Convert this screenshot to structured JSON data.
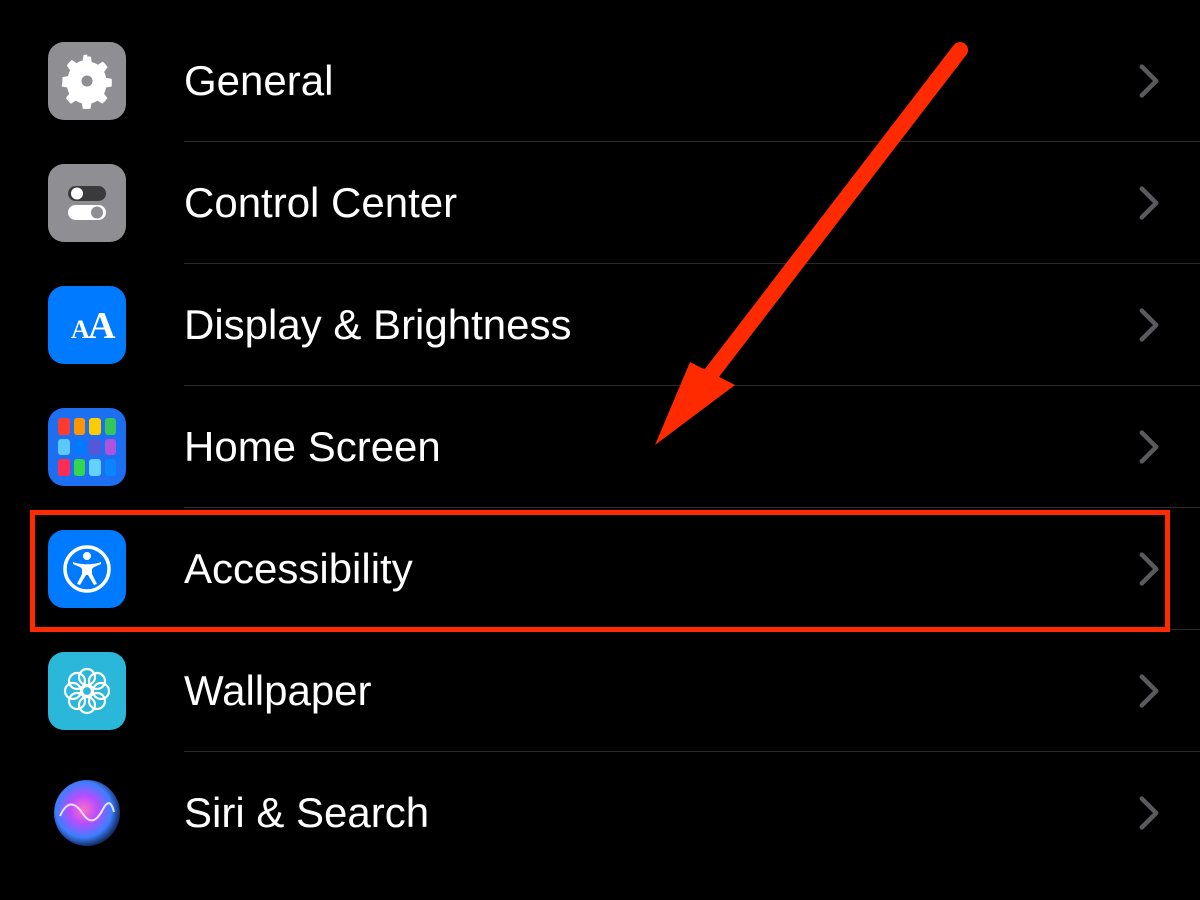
{
  "settings": {
    "items": [
      {
        "id": "general",
        "label": "General",
        "icon": "gear-icon",
        "icon_bg": "#8e8e93"
      },
      {
        "id": "control-center",
        "label": "Control Center",
        "icon": "toggles-icon",
        "icon_bg": "#8e8e93"
      },
      {
        "id": "display",
        "label": "Display & Brightness",
        "icon": "text-size-icon",
        "icon_bg": "#007aff"
      },
      {
        "id": "home-screen",
        "label": "Home Screen",
        "icon": "app-grid-icon",
        "icon_bg": "#1d6ff2"
      },
      {
        "id": "accessibility",
        "label": "Accessibility",
        "icon": "accessibility-icon",
        "icon_bg": "#007aff"
      },
      {
        "id": "wallpaper",
        "label": "Wallpaper",
        "icon": "flower-icon",
        "icon_bg": "#2bb7d9"
      },
      {
        "id": "siri",
        "label": "Siri & Search",
        "icon": "siri-icon",
        "icon_bg": "siri-gradient"
      }
    ],
    "highlighted_item_id": "accessibility",
    "annotation_arrow_color": "#ff2a00"
  }
}
